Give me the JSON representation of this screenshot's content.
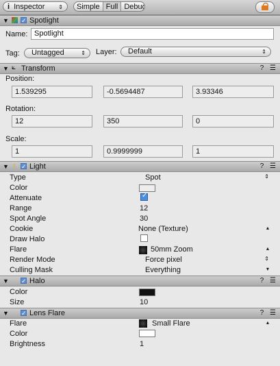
{
  "toolbar": {
    "inspector_label": "Inspector",
    "modes": [
      "Simple",
      "Full",
      "Debug"
    ],
    "active_mode": "Full",
    "lock_icon": "lock-icon"
  },
  "object_section": {
    "title": "Spotlight",
    "name_label": "Name:",
    "name_value": "Spotlight",
    "tag_label": "Tag:",
    "tag_value": "Untagged",
    "layer_label": "Layer:",
    "layer_value": "Default"
  },
  "transform": {
    "title": "Transform",
    "position_label": "Position:",
    "position": [
      "1.539295",
      "-0.5694487",
      "3.93346"
    ],
    "rotation_label": "Rotation:",
    "rotation": [
      "12",
      "350",
      "0"
    ],
    "scale_label": "Scale:",
    "scale": [
      "1",
      "0.9999999",
      "1"
    ]
  },
  "light": {
    "title": "Light",
    "rows": [
      {
        "label": "Type",
        "value": "Spot"
      },
      {
        "label": "Color",
        "value": ""
      },
      {
        "label": "Attenuate",
        "value": ""
      },
      {
        "label": "Range",
        "value": "12"
      },
      {
        "label": "Spot Angle",
        "value": "30"
      },
      {
        "label": "Cookie",
        "value": "None (Texture)"
      },
      {
        "label": "Draw Halo",
        "value": ""
      },
      {
        "label": "Flare",
        "value": "50mm Zoom"
      },
      {
        "label": "Render Mode",
        "value": "Force pixel"
      },
      {
        "label": "Culling Mask",
        "value": "Everything"
      }
    ],
    "color": "#ededed",
    "attenuate": true,
    "draw_halo": false
  },
  "halo": {
    "title": "Halo",
    "rows": [
      {
        "label": "Color",
        "value": ""
      },
      {
        "label": "Size",
        "value": "10"
      }
    ],
    "color": "#111111"
  },
  "lens_flare": {
    "title": "Lens Flare",
    "rows": [
      {
        "label": "Flare",
        "value": "Small Flare"
      },
      {
        "label": "Color",
        "value": ""
      },
      {
        "label": "Brightness",
        "value": "1"
      }
    ],
    "color": "#ffffff"
  },
  "header_actions": {
    "help": "?",
    "settings": "☰"
  }
}
